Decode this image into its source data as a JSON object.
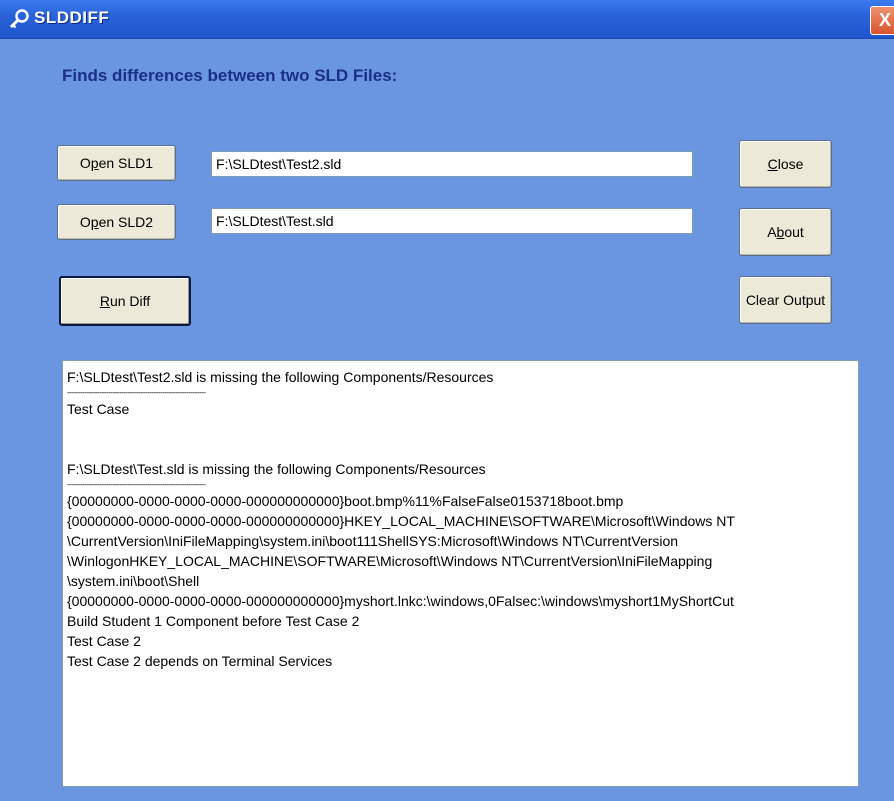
{
  "window": {
    "title": "SLDDIFF",
    "close_glyph": "X",
    "heading": "Finds differences between two SLD Files:"
  },
  "buttons": {
    "open1_pre": "O",
    "open1_u": "p",
    "open1_post": "en SLD1",
    "open2_pre": "O",
    "open2_u": "p",
    "open2_post": "en SLD2",
    "run_u": "R",
    "run_post": "un Diff",
    "close_u": "C",
    "close_post": "lose",
    "about_pre": "A",
    "about_u": "b",
    "about_post": "out",
    "clear": "Clear Output"
  },
  "fields": {
    "sld1": "F:\\SLDtest\\Test2.sld",
    "sld2": "F:\\SLDtest\\Test.sld"
  },
  "output": {
    "lines": [
      "F:\\SLDtest\\Test2.sld is missing the following Components/Resources",
      "----------------------------------------------------------------",
      "Test Case",
      "",
      "",
      "F:\\SLDtest\\Test.sld is missing the following Components/Resources",
      "----------------------------------------------------------------",
      "{00000000-0000-0000-0000-000000000000}boot.bmp%11%FalseFalse0153718boot.bmp",
      "{00000000-0000-0000-0000-000000000000}HKEY_LOCAL_MACHINE\\SOFTWARE\\Microsoft\\Windows NT",
      "\\CurrentVersion\\IniFileMapping\\system.ini\\boot111ShellSYS:Microsoft\\Windows NT\\CurrentVersion",
      "\\WinlogonHKEY_LOCAL_MACHINE\\SOFTWARE\\Microsoft\\Windows NT\\CurrentVersion\\IniFileMapping",
      "\\system.ini\\boot\\Shell",
      "{00000000-0000-0000-0000-000000000000}myshort.lnkc:\\windows,0Falsec:\\windows\\myshort1MyShortCut",
      "Build Student 1 Component before Test Case 2",
      "Test Case 2",
      "Test Case 2 depends on Terminal Services"
    ]
  },
  "icons": {
    "title": "key-icon"
  }
}
